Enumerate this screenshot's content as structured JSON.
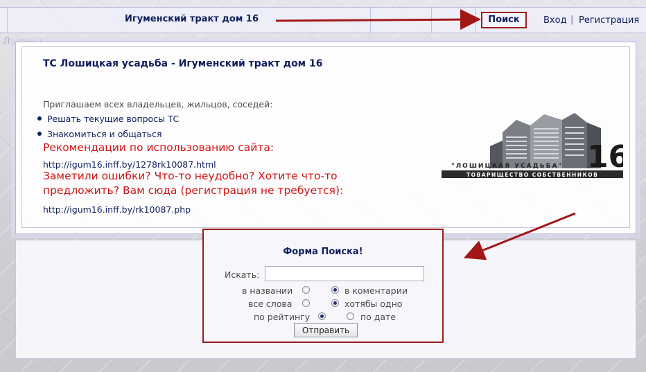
{
  "header": {
    "site_title": "Игуменский тракт дом 16",
    "search_label": "Поиск",
    "login_label": "Вход",
    "separator": "|",
    "register_label": "Регистрация"
  },
  "background": {
    "word": "Лучины"
  },
  "intro": {
    "heading": "ТС Лошицкая усадьба - Игуменский тракт дом 16",
    "invite": "Приглашаем всех владельцев, жильцов, соседей:",
    "bullets": [
      "Решать текущие вопросы ТС",
      "Знакомиться и общаться"
    ],
    "recommendations": "Рекомендации по использованию сайта:",
    "recommendations_url": "http://igum16.inff.by/1278rk10087.html",
    "feedback_line1": "Заметили ошибки? Что-то неудобно? Хотите что-то",
    "feedback_line2": "предложить? Вам сюда (регистрация не требуется):",
    "feedback_url": "http://igum16.inff.by/rk10087.php"
  },
  "logo": {
    "number": "16",
    "name": "\"ЛОШИЦКАЯ УСАДЬБА\"",
    "subtitle": "ТОВАРИЩЕСТВО СОБСТВЕННИКОВ"
  },
  "search_form": {
    "title": "Форма Поиска!",
    "search_label": "Искать:",
    "search_value": "",
    "in_title": "в названии",
    "in_comments": "в коментарии",
    "all_words": "все слова",
    "any_word": "хотябы одно",
    "by_rating": "по рейтингу",
    "by_date": "по дате",
    "submit_label": "Отправить",
    "selected": {
      "scope": "в коментарии",
      "match": "хотябы одно",
      "sort": "по рейтингу"
    }
  },
  "colors": {
    "link": "#0e1f5c",
    "highlight_red": "#d01313",
    "annotation_red": "#9b1c1c"
  }
}
